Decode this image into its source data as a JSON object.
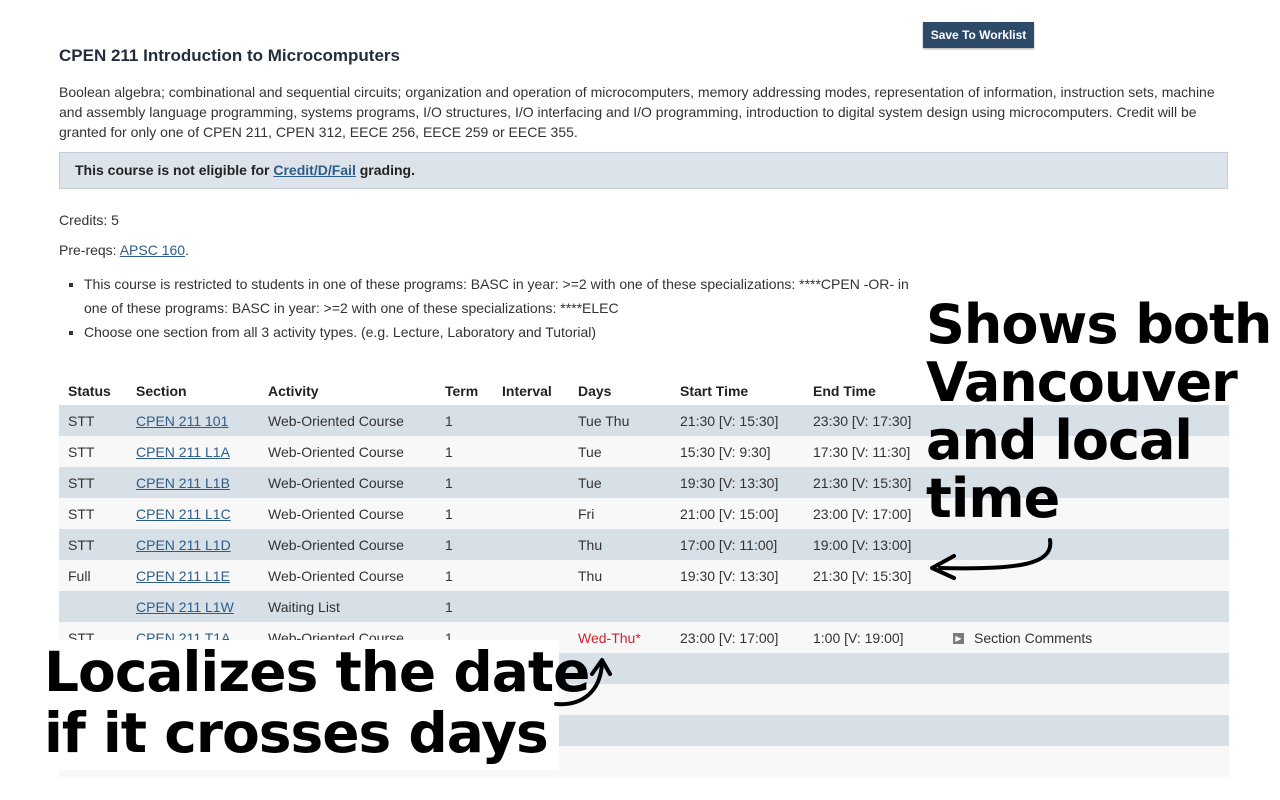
{
  "save_button": "Save To Worklist",
  "course": {
    "title": "CPEN 211 Introduction to Microcomputers",
    "description": "Boolean algebra; combinational and sequential circuits; organization and operation of microcomputers, memory addressing modes, representation of information, instruction sets, machine and assembly language programming, systems programs, I/O structures, I/O interfacing and I/O programming, introduction to digital system design using microcomputers. Credit will be granted for only one of CPEN 211, CPEN 312, EECE 256, EECE 259 or EECE 355.",
    "notice_prefix": "This course is not eligible for ",
    "notice_link": "Credit/D/Fail",
    "notice_suffix": " grading.",
    "credits": "Credits: 5",
    "prereq_label": "Pre-reqs: ",
    "prereq_link": "APSC 160",
    "prereq_suffix": ".",
    "restrictions": [
      "This course is restricted to students in one of these programs: BASC in year: >=2 with one of these specializations: ****CPEN -OR- in one of these programs: BASC in year: >=2 with one of these specializations: ****ELEC",
      "Choose one section from all 3 activity types. (e.g. Lecture, Laboratory and Tutorial)"
    ]
  },
  "table": {
    "headers": [
      "Status",
      "Section",
      "Activity",
      "Term",
      "Interval",
      "Days",
      "Start Time",
      "End Time",
      ""
    ],
    "rows": [
      {
        "status": "STT",
        "section": "CPEN 211 101",
        "activity": "Web-Oriented Course",
        "term": "1",
        "interval": "",
        "days": "Tue  Thu",
        "start": "21:30 [V: 15:30]",
        "end": "23:30 [V: 17:30]",
        "comments": ""
      },
      {
        "status": "STT",
        "section": "CPEN 211 L1A",
        "activity": "Web-Oriented Course",
        "term": "1",
        "interval": "",
        "days": "Tue",
        "start": "15:30 [V: 9:30]",
        "end": "17:30 [V: 11:30]",
        "comments": ""
      },
      {
        "status": "STT",
        "section": "CPEN 211 L1B",
        "activity": "Web-Oriented Course",
        "term": "1",
        "interval": "",
        "days": "Tue",
        "start": "19:30 [V: 13:30]",
        "end": "21:30 [V: 15:30]",
        "comments": ""
      },
      {
        "status": "STT",
        "section": "CPEN 211 L1C",
        "activity": "Web-Oriented Course",
        "term": "1",
        "interval": "",
        "days": "Fri",
        "start": "21:00 [V: 15:00]",
        "end": "23:00 [V: 17:00]",
        "comments": ""
      },
      {
        "status": "STT",
        "section": "CPEN 211 L1D",
        "activity": "Web-Oriented Course",
        "term": "1",
        "interval": "",
        "days": "Thu",
        "start": "17:00 [V: 11:00]",
        "end": "19:00 [V: 13:00]",
        "comments": ""
      },
      {
        "status": "Full",
        "section": "CPEN 211 L1E",
        "activity": "Web-Oriented Course",
        "term": "1",
        "interval": "",
        "days": "Thu",
        "start": "19:30 [V: 13:30]",
        "end": "21:30 [V: 15:30]",
        "comments": ""
      },
      {
        "status": "",
        "section": "CPEN 211 L1W",
        "activity": "Waiting List",
        "term": "1",
        "interval": "",
        "days": "",
        "start": "",
        "end": "",
        "comments": ""
      },
      {
        "status": "STT",
        "section": "CPEN 211 T1A",
        "activity": "Web-Oriented Course",
        "term": "1",
        "interval": "",
        "days": "Wed-Thu*",
        "start": "23:00 [V: 17:00]",
        "end": "1:00 [V: 19:00]",
        "comments": "Section Comments",
        "cross_day": true
      },
      {
        "status": "",
        "section": "",
        "activity": "",
        "term": "",
        "interval": "",
        "days": "",
        "start": "",
        "end": "",
        "comments": ""
      },
      {
        "status": "",
        "section": "",
        "activity": "",
        "term": "",
        "interval": "",
        "days": "",
        "start": "",
        "end": "",
        "comments": ""
      },
      {
        "status": "",
        "section": "",
        "activity": "",
        "term": "",
        "interval": "",
        "days": "",
        "start": "",
        "end": "",
        "comments": ""
      },
      {
        "status": "",
        "section": "",
        "activity": "",
        "term": "",
        "interval": "",
        "days": "",
        "start": "",
        "end": "",
        "comments": ""
      }
    ]
  },
  "callouts": {
    "timezone": [
      "Shows both",
      "Vancouver",
      "and local",
      "time"
    ],
    "date": [
      "Localizes the date",
      "if it crosses days"
    ]
  }
}
